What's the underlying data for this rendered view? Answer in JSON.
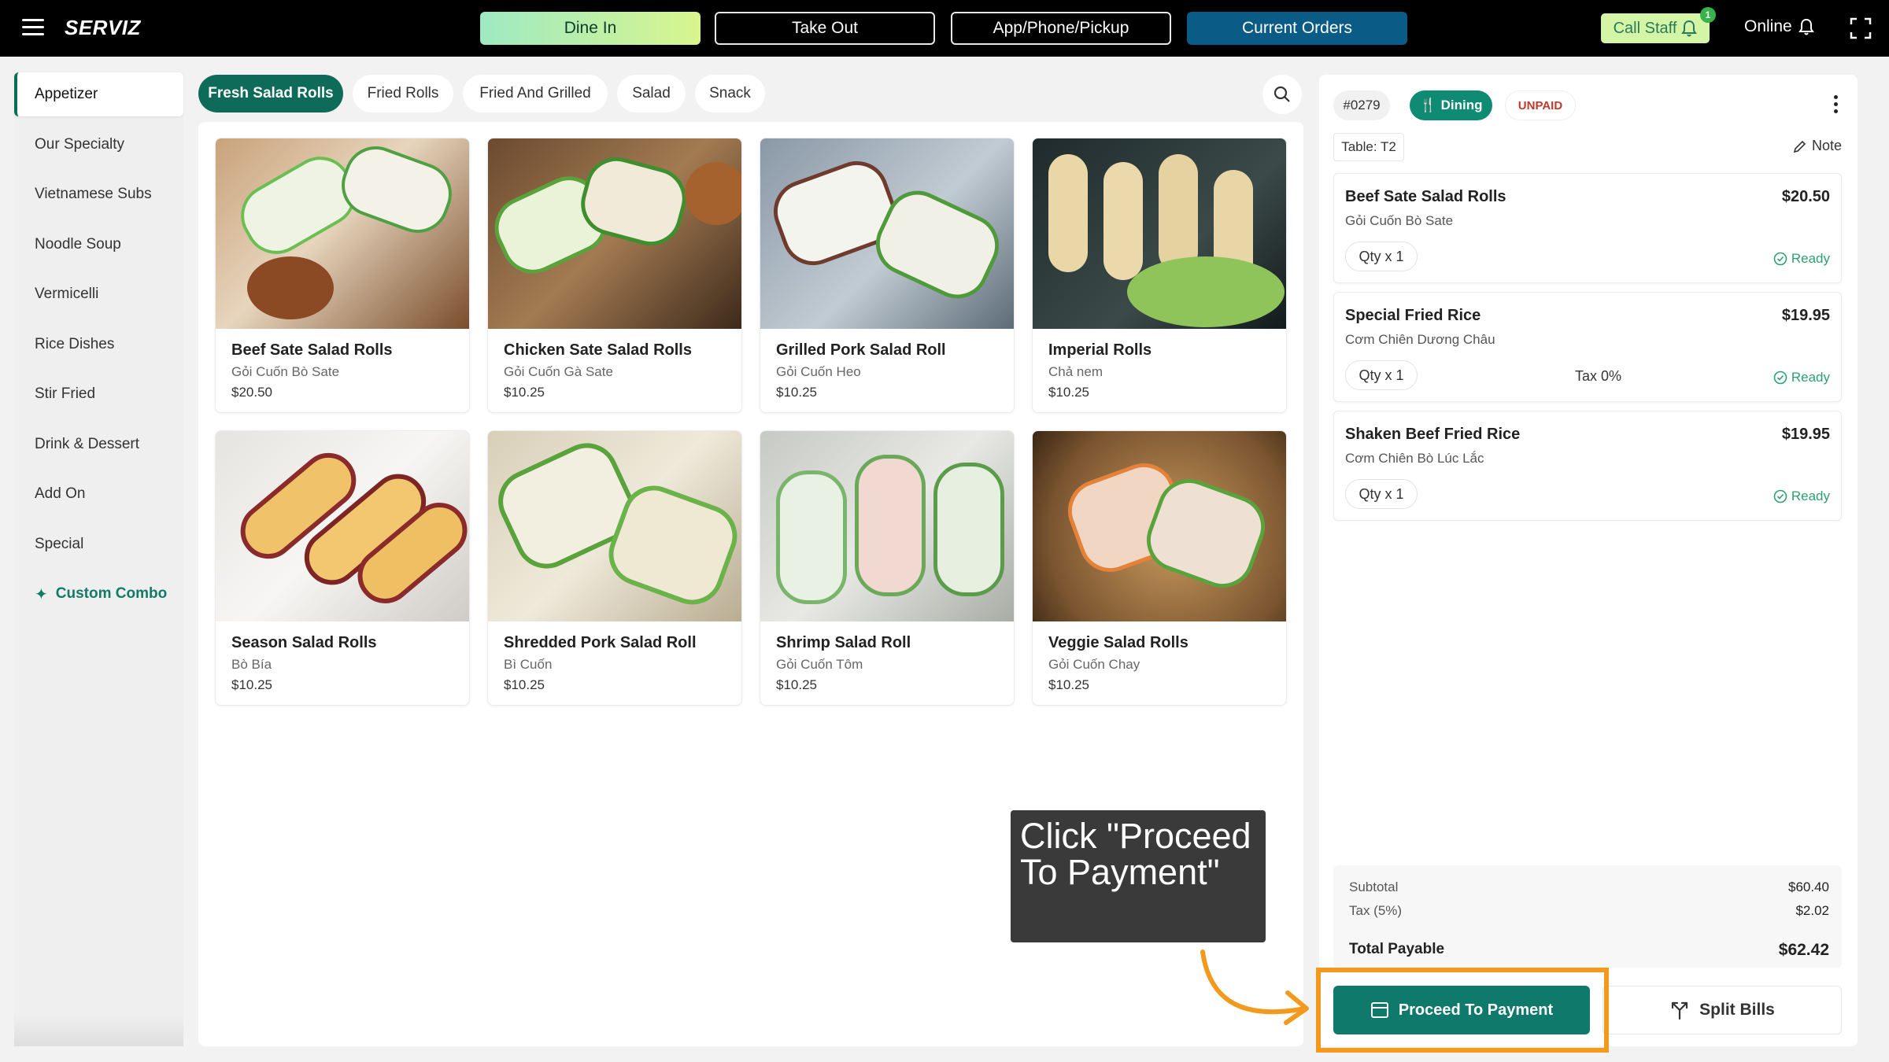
{
  "app": {
    "brand": "SERVIZ"
  },
  "topbar": {
    "tabs": [
      {
        "label": "Dine In"
      },
      {
        "label": "Take Out"
      },
      {
        "label": "App/Phone/Pickup"
      },
      {
        "label": "Current Orders"
      }
    ],
    "call_staff": "Call Staff",
    "call_staff_badge": "1",
    "online": "Online"
  },
  "categories": [
    {
      "label": "Appetizer"
    },
    {
      "label": "Our Specialty"
    },
    {
      "label": "Vietnamese Subs"
    },
    {
      "label": "Noodle Soup"
    },
    {
      "label": "Vermicelli"
    },
    {
      "label": "Rice Dishes"
    },
    {
      "label": "Stir Fried"
    },
    {
      "label": "Drink & Dessert"
    },
    {
      "label": "Add On"
    },
    {
      "label": "Special"
    },
    {
      "label": "Custom Combo"
    }
  ],
  "subcategories": [
    {
      "label": "Fresh Salad Rolls"
    },
    {
      "label": "Fried Rolls"
    },
    {
      "label": "Fried And Grilled"
    },
    {
      "label": "Salad"
    },
    {
      "label": "Snack"
    }
  ],
  "products": [
    {
      "name": "Beef Sate Salad Rolls",
      "sub": "Gỏi Cuốn Bò Sate",
      "price": "$20.50"
    },
    {
      "name": "Chicken Sate Salad Rolls",
      "sub": "Gỏi Cuốn Gà Sate",
      "price": "$10.25"
    },
    {
      "name": "Grilled Pork Salad Roll",
      "sub": "Gỏi Cuốn Heo",
      "price": "$10.25"
    },
    {
      "name": "Imperial Rolls",
      "sub": "Chả nem",
      "price": "$10.25"
    },
    {
      "name": "Season Salad Rolls",
      "sub": "Bò Bía",
      "price": "$10.25"
    },
    {
      "name": "Shredded Pork Salad Roll",
      "sub": "Bì Cuốn",
      "price": "$10.25"
    },
    {
      "name": "Shrimp Salad Roll",
      "sub": "Gỏi Cuốn Tôm",
      "price": "$10.25"
    },
    {
      "name": "Veggie Salad Rolls",
      "sub": "Gỏi Cuốn Chay",
      "price": "$10.25"
    }
  ],
  "tooltip": {
    "text": "Click \"Proceed To Payment\""
  },
  "order": {
    "number": "#0279",
    "type": "Dining",
    "status": "UNPAID",
    "table": "Table: T2",
    "note": "Note",
    "items": [
      {
        "name": "Beef Sate Salad Rolls",
        "sub": "Gỏi Cuốn Bò Sate",
        "price": "$20.50",
        "qty": "Qty x 1",
        "tax": "",
        "status": "Ready"
      },
      {
        "name": "Special Fried Rice",
        "sub": "Cơm Chiên Dương Châu",
        "price": "$19.95",
        "qty": "Qty x 1",
        "tax": "Tax 0%",
        "status": "Ready"
      },
      {
        "name": "Shaken Beef Fried Rice",
        "sub": "Cơm Chiên Bò Lúc Lắc",
        "price": "$19.95",
        "qty": "Qty x 1",
        "tax": "",
        "status": "Ready"
      }
    ],
    "subtotal_label": "Subtotal",
    "subtotal": "$60.40",
    "tax_label": "Tax (5%)",
    "tax": "$2.02",
    "total_label": "Total Payable",
    "total": "$62.42",
    "proceed_label": "Proceed To Payment",
    "split_label": "Split Bills"
  },
  "colors": {
    "accent": "#0f7a6b",
    "current_orders": "#0a5c86",
    "highlight": "#f39a1e",
    "unpaid": "#c0392b"
  }
}
